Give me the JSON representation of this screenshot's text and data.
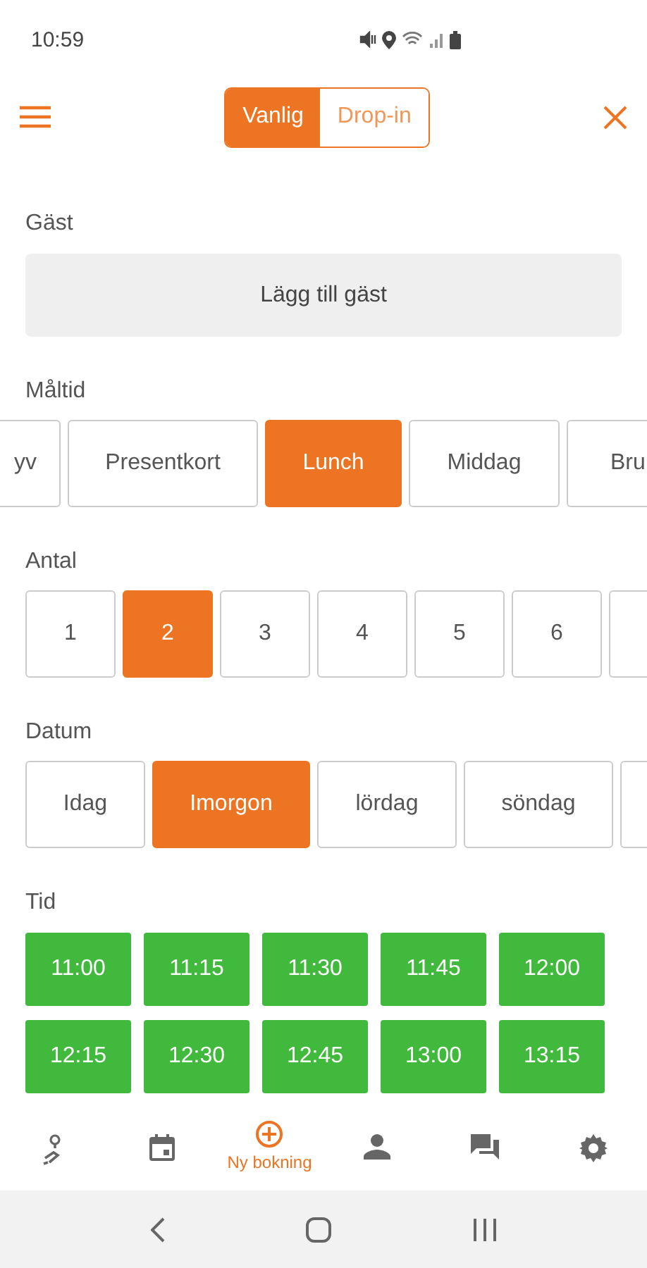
{
  "status_bar": {
    "time": "10:59"
  },
  "header": {
    "modes": [
      {
        "label": "Vanlig",
        "selected": true
      },
      {
        "label": "Drop-in",
        "selected": false
      }
    ]
  },
  "guest": {
    "label": "Gäst",
    "button": "Lägg till gäst"
  },
  "meal": {
    "label": "Måltid",
    "options": [
      {
        "label": "yv",
        "selected": false
      },
      {
        "label": "Presentkort",
        "selected": false
      },
      {
        "label": "Lunch",
        "selected": true
      },
      {
        "label": "Middag",
        "selected": false
      },
      {
        "label": "Bru",
        "selected": false
      }
    ]
  },
  "count": {
    "label": "Antal",
    "options": [
      {
        "label": "1",
        "selected": false
      },
      {
        "label": "2",
        "selected": true
      },
      {
        "label": "3",
        "selected": false
      },
      {
        "label": "4",
        "selected": false
      },
      {
        "label": "5",
        "selected": false
      },
      {
        "label": "6",
        "selected": false
      },
      {
        "selected": false
      }
    ]
  },
  "date": {
    "label": "Datum",
    "options": [
      {
        "label": "Idag",
        "selected": false
      },
      {
        "label": "Imorgon",
        "selected": true
      },
      {
        "label": "lördag",
        "selected": false
      },
      {
        "label": "söndag",
        "selected": false
      },
      {
        "selected": false
      }
    ]
  },
  "time": {
    "label": "Tid",
    "slots": [
      "11:00",
      "11:15",
      "11:30",
      "11:45",
      "12:00",
      "12:15",
      "12:30",
      "12:45",
      "13:00",
      "13:15"
    ]
  },
  "bottom_nav": [
    {
      "kind": "map",
      "selected": false
    },
    {
      "kind": "calendar",
      "selected": false
    },
    {
      "kind": "add",
      "label": "Ny bokning",
      "selected": true
    },
    {
      "kind": "person",
      "selected": false
    },
    {
      "kind": "chat",
      "selected": false
    },
    {
      "kind": "gear",
      "selected": false
    }
  ]
}
